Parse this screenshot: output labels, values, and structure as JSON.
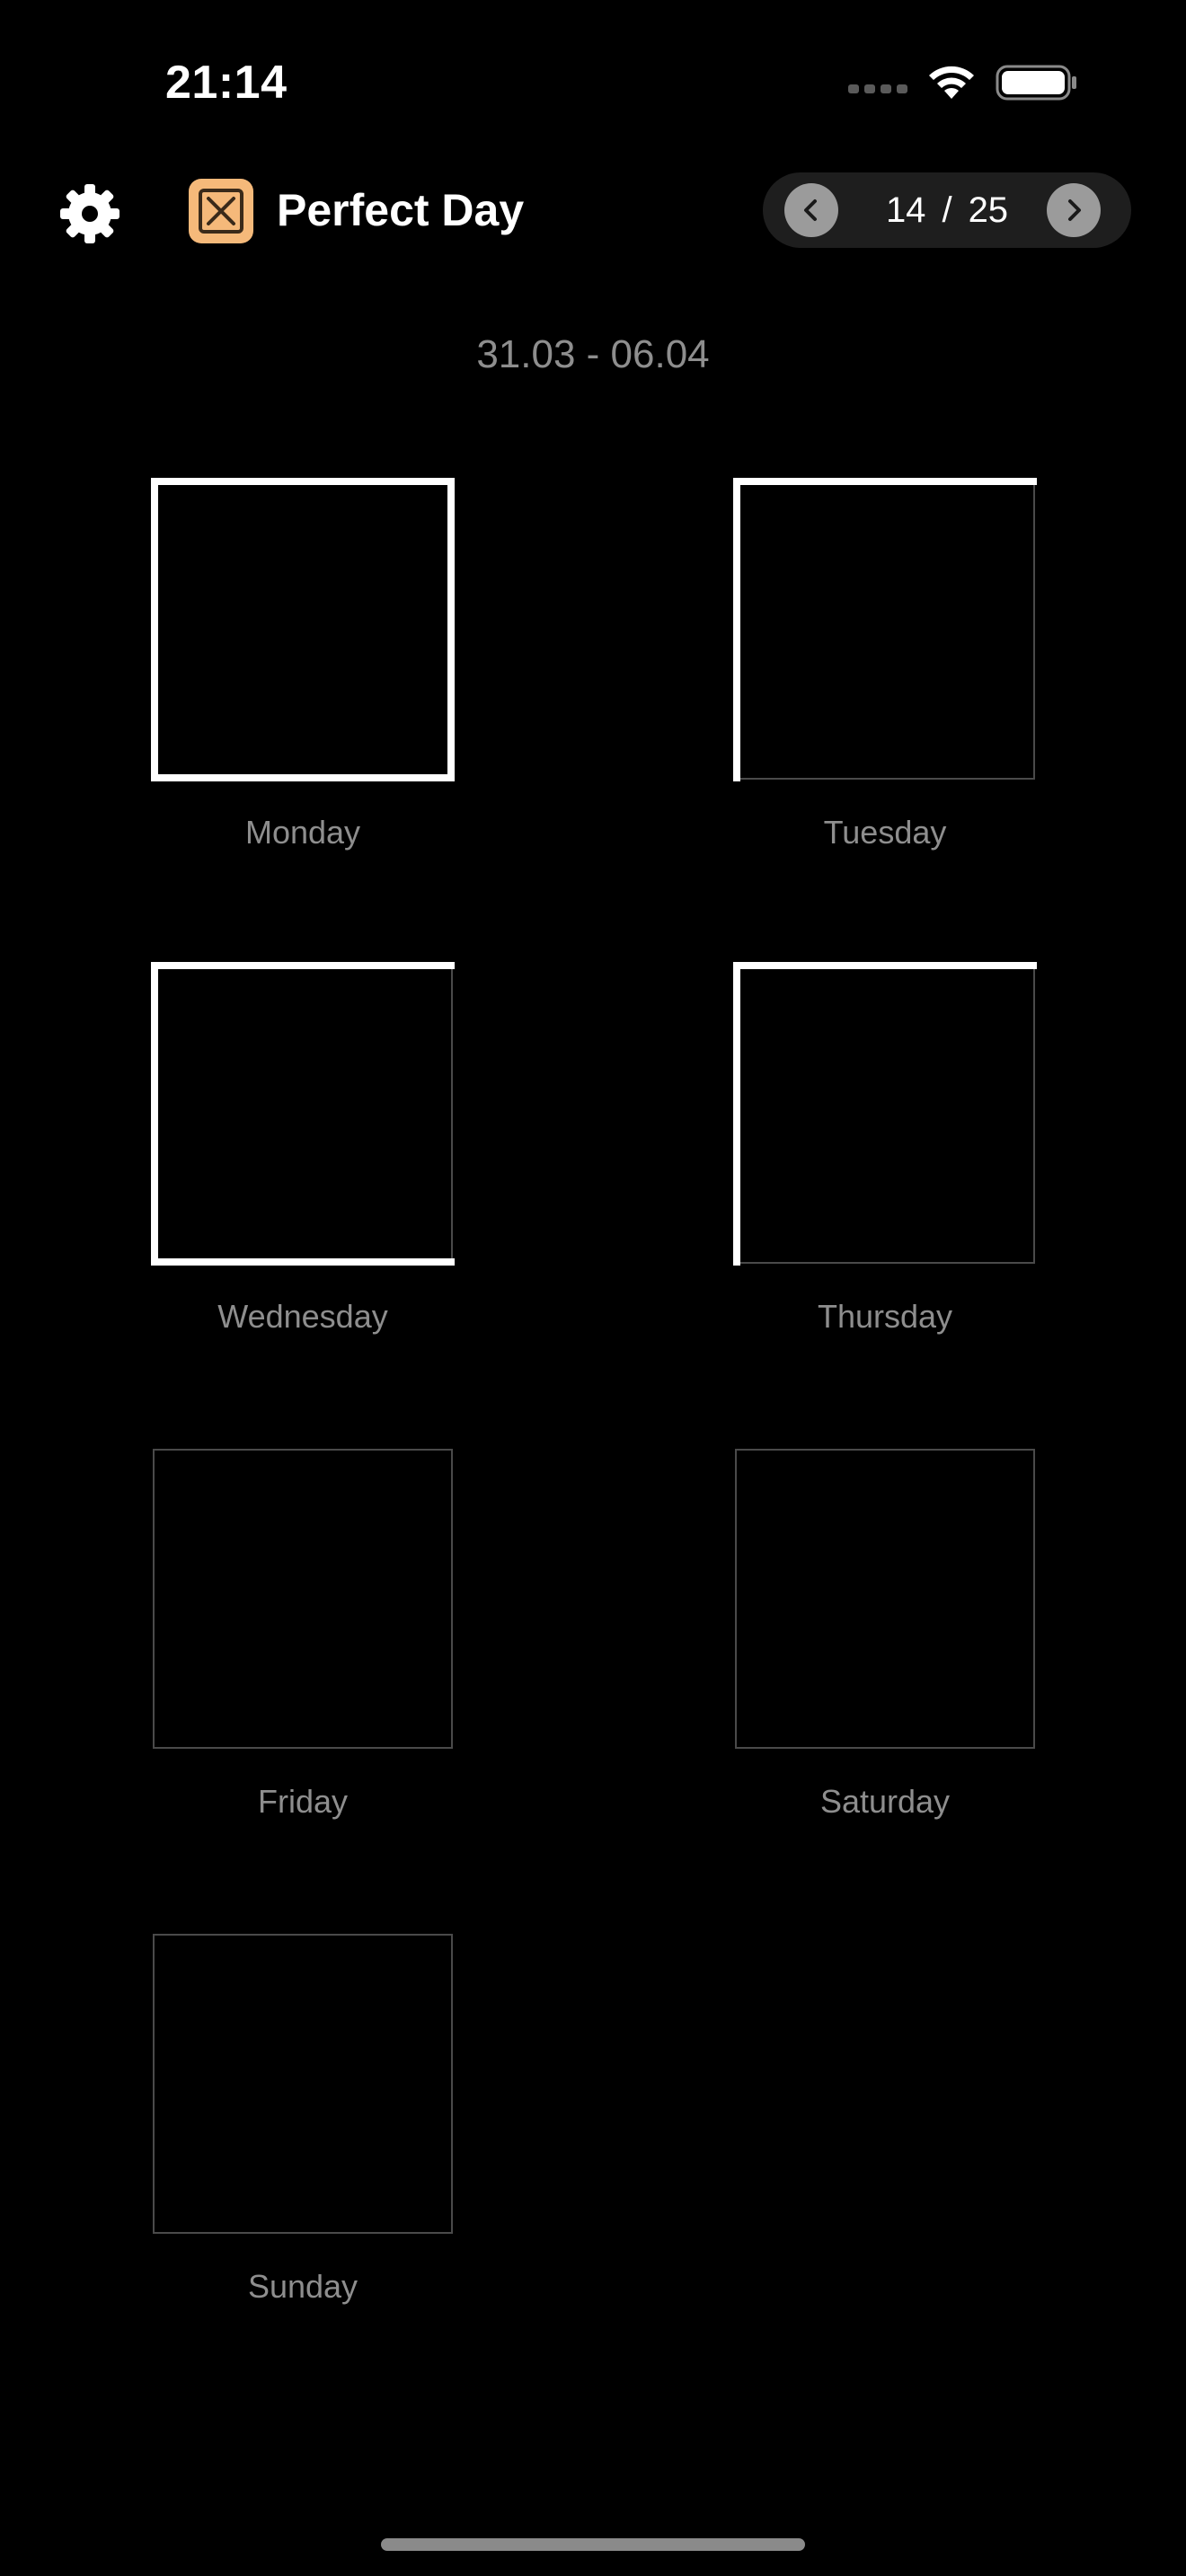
{
  "status_bar": {
    "time": "21:14"
  },
  "header": {
    "title": "Perfect Day",
    "settings_icon": "gear-icon",
    "app_icon": "x-square-icon",
    "app_icon_color": "#f5b97a"
  },
  "pager": {
    "current": "14",
    "separator": "/",
    "total": "25"
  },
  "date_range": "31.03 - 06.04",
  "days": [
    {
      "label": "Monday",
      "edges": [
        "top",
        "right",
        "bottom",
        "left"
      ]
    },
    {
      "label": "Tuesday",
      "edges": [
        "top",
        "left"
      ]
    },
    {
      "label": "Wednesday",
      "edges": [
        "top",
        "bottom",
        "left"
      ]
    },
    {
      "label": "Thursday",
      "edges": [
        "top",
        "left"
      ]
    },
    {
      "label": "Friday",
      "edges": []
    },
    {
      "label": "Saturday",
      "edges": []
    },
    {
      "label": "Sunday",
      "edges": []
    }
  ],
  "colors": {
    "background": "#000000",
    "edge_active": "#ffffff",
    "edge_inactive": "#4a4a4a",
    "label": "#8e8e8e"
  }
}
